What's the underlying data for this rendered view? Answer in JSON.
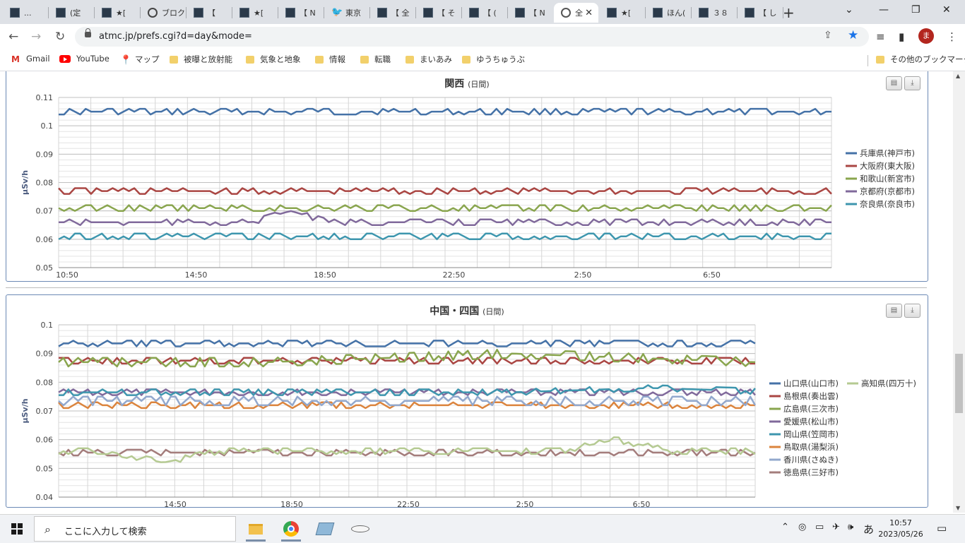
{
  "browser": {
    "tabs": [
      {
        "label": "...",
        "icon": "site-icon",
        "fav": "dark"
      },
      {
        "label": "(定",
        "icon": "site-icon",
        "fav": "dark"
      },
      {
        "label": "★[",
        "icon": "site-icon",
        "fav": "dark"
      },
      {
        "label": "ブロク",
        "icon": "blog-icon",
        "fav": "circ"
      },
      {
        "label": "【",
        "icon": "site-icon",
        "fav": "dark"
      },
      {
        "label": "★[",
        "icon": "site-icon",
        "fav": "dark"
      },
      {
        "label": "【 N",
        "icon": "site-icon",
        "fav": "dark"
      },
      {
        "label": "東京",
        "icon": "twitter-icon",
        "fav": "tw"
      },
      {
        "label": "【 全",
        "icon": "site-icon",
        "fav": "dark"
      },
      {
        "label": "【 そ",
        "icon": "site-icon",
        "fav": "dark"
      },
      {
        "label": "【 (",
        "icon": "site-icon",
        "fav": "dark"
      },
      {
        "label": "【 N",
        "icon": "site-icon",
        "fav": "dark"
      },
      {
        "label": "全",
        "icon": "globe-icon",
        "fav": "globe",
        "active": true
      },
      {
        "label": "★[",
        "icon": "site-icon",
        "fav": "dark"
      },
      {
        "label": "ほん(",
        "icon": "site-icon",
        "fav": "dark"
      },
      {
        "label": "３８",
        "icon": "site-icon",
        "fav": "dark"
      },
      {
        "label": "【 し",
        "icon": "site-icon",
        "fav": "dark"
      }
    ],
    "url": "atmc.jp/prefs.cgi?d=day&mode=",
    "profile_initial": "ま",
    "bookmarks": [
      {
        "label": "Gmail",
        "icon": "gmail-icon"
      },
      {
        "label": "YouTube",
        "icon": "youtube-icon"
      },
      {
        "label": "マップ",
        "icon": "maps-icon"
      },
      {
        "label": "被曝と放射能",
        "icon": "folder-icon"
      },
      {
        "label": "気象と地象",
        "icon": "folder-icon"
      },
      {
        "label": "情報",
        "icon": "folder-icon"
      },
      {
        "label": "転職",
        "icon": "folder-icon"
      },
      {
        "label": "まいあみ",
        "icon": "folder-icon"
      },
      {
        "label": "ゆうちゅうぶ",
        "icon": "folder-icon"
      }
    ],
    "other_bookmarks": "その他のブックマーク"
  },
  "chart_data": [
    {
      "type": "line",
      "title": "関西",
      "subtitle": "(日間)",
      "ylabel": "μSv/h",
      "ylim": [
        0.05,
        0.11
      ],
      "yticks": [
        "0.11",
        "0.1",
        "0.09",
        "0.08",
        "0.07",
        "0.06",
        "0.05"
      ],
      "xticks": [
        "10:50",
        "14:50",
        "18:50",
        "22:50",
        "2:50",
        "6:50"
      ],
      "points": 144,
      "grid": true,
      "legend_position": "right",
      "series": [
        {
          "name": "兵庫県(神戸市)",
          "color": "#4572a7",
          "base": 0.105,
          "jitter": 0.001,
          "dips": []
        },
        {
          "name": "大阪府(東大阪)",
          "color": "#aa4643",
          "base": 0.077,
          "jitter": 0.001,
          "dips": []
        },
        {
          "name": "和歌山(新宮市)",
          "color": "#89a54e",
          "base": 0.071,
          "jitter": 0.001,
          "dips": []
        },
        {
          "name": "京都府(京都市)",
          "color": "#80699b",
          "base": 0.066,
          "jitter": 0.001,
          "dips": [
            {
              "at": 0.3,
              "value": 0.07,
              "width": 0.05
            }
          ]
        },
        {
          "name": "奈良県(奈良市)",
          "color": "#3d96ae",
          "base": 0.061,
          "jitter": 0.001,
          "dips": []
        }
      ]
    },
    {
      "type": "line",
      "title": "中国・四国",
      "subtitle": "(日間)",
      "ylabel": "μSv/h",
      "ylim": [
        0.04,
        0.1
      ],
      "yticks": [
        "0.1",
        "0.09",
        "0.08",
        "0.07",
        "0.06",
        "0.05",
        "0.04"
      ],
      "xticks": [
        "14:50",
        "18:50",
        "22:50",
        "2:50",
        "6:50"
      ],
      "points": 144,
      "grid": true,
      "legend_position": "right",
      "series": [
        {
          "name": "山口県(山口市)",
          "color": "#4572a7",
          "base": 0.0935,
          "jitter": 0.001,
          "dips": []
        },
        {
          "name": "島根県(奏出雲)",
          "color": "#aa4643",
          "base": 0.0875,
          "jitter": 0.001,
          "dips": []
        },
        {
          "name": "広島県(三次市)",
          "color": "#89a54e",
          "base": 0.087,
          "jitter": 0.0015,
          "dips": [
            {
              "at": 0.65,
              "value": 0.09,
              "width": 0.35
            }
          ]
        },
        {
          "name": "愛媛県(松山市)",
          "color": "#80699b",
          "base": 0.0765,
          "jitter": 0.001,
          "dips": []
        },
        {
          "name": "岡山県(笠岡市)",
          "color": "#3d96ae",
          "base": 0.0765,
          "jitter": 0.001,
          "dips": [
            {
              "at": 0.85,
              "value": 0.078,
              "width": 0.2
            }
          ]
        },
        {
          "name": "鳥取県(湯梨浜)",
          "color": "#db843d",
          "base": 0.072,
          "jitter": 0.001,
          "dips": []
        },
        {
          "name": "香川県(さぬき)",
          "color": "#92a8cd",
          "base": 0.0735,
          "jitter": 0.0015,
          "dips": []
        },
        {
          "name": "徳島県(三好市)",
          "color": "#a47d7c",
          "base": 0.0555,
          "jitter": 0.001,
          "dips": []
        },
        {
          "name": "高知県(四万十)",
          "color": "#b5ca92",
          "base": 0.056,
          "jitter": 0.001,
          "dips": [
            {
              "at": 0.15,
              "value": 0.052,
              "width": 0.08
            },
            {
              "at": 0.8,
              "value": 0.06,
              "width": 0.08
            }
          ]
        }
      ]
    }
  ],
  "taskbar": {
    "search_placeholder": "ここに入力して検索",
    "time": "10:57",
    "date": "2023/05/26",
    "ime": "あ"
  }
}
